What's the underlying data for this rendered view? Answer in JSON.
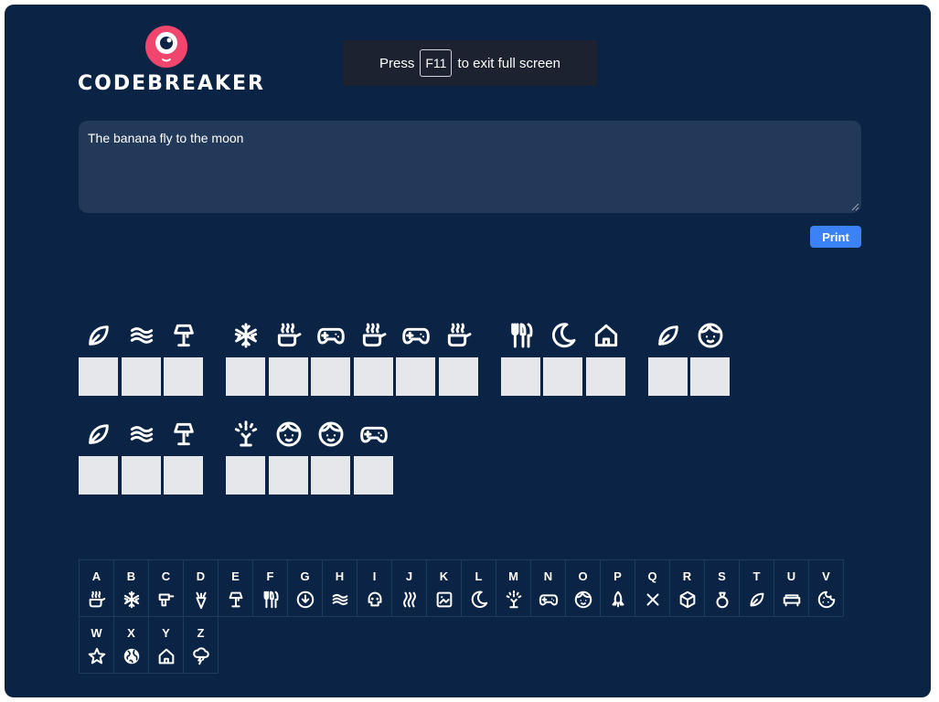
{
  "logo": {
    "text": "CODEBREAKER",
    "accent": "#f0466e"
  },
  "fullscreen_notice": {
    "prefix": "Press",
    "key": "F11",
    "suffix": "to exit full screen"
  },
  "message": {
    "value": "The banana fly to the moon"
  },
  "print_button": {
    "label": "Print",
    "color": "#3b82f6"
  },
  "colors": {
    "background": "#0b2344",
    "textarea": "#23395a",
    "blank": "#e5e7eb"
  },
  "puzzle": {
    "lines": [
      [
        [
          "leaf-icon",
          "waves-icon",
          "lamp-icon"
        ],
        [
          "snowflake-icon",
          "pot-icon",
          "gamepad-icon",
          "pot-icon",
          "gamepad-icon",
          "pot-icon"
        ],
        [
          "cutlery-icon",
          "moon-icon",
          "home-icon"
        ],
        [
          "leaf-icon",
          "face-icon"
        ]
      ],
      [
        [
          "leaf-icon",
          "waves-icon",
          "lamp-icon"
        ],
        [
          "sprinkle-icon",
          "face-icon",
          "face-icon",
          "gamepad-icon"
        ]
      ]
    ]
  },
  "key": [
    {
      "letter": "A",
      "icon": "pot-icon"
    },
    {
      "letter": "B",
      "icon": "snowflake-icon"
    },
    {
      "letter": "C",
      "icon": "drill-icon"
    },
    {
      "letter": "D",
      "icon": "carrot-icon"
    },
    {
      "letter": "E",
      "icon": "lamp-icon"
    },
    {
      "letter": "F",
      "icon": "cutlery-icon"
    },
    {
      "letter": "G",
      "icon": "download-icon"
    },
    {
      "letter": "H",
      "icon": "waves-icon"
    },
    {
      "letter": "I",
      "icon": "skull-icon"
    },
    {
      "letter": "J",
      "icon": "steam-icon"
    },
    {
      "letter": "K",
      "icon": "picture-icon"
    },
    {
      "letter": "L",
      "icon": "moon-icon"
    },
    {
      "letter": "M",
      "icon": "sprinkle-icon"
    },
    {
      "letter": "N",
      "icon": "gamepad-icon"
    },
    {
      "letter": "O",
      "icon": "face-icon"
    },
    {
      "letter": "P",
      "icon": "rocket-icon"
    },
    {
      "letter": "Q",
      "icon": "cross-icon"
    },
    {
      "letter": "R",
      "icon": "cube-icon"
    },
    {
      "letter": "S",
      "icon": "ring-icon"
    },
    {
      "letter": "T",
      "icon": "leaf-icon"
    },
    {
      "letter": "U",
      "icon": "sofa-icon"
    },
    {
      "letter": "V",
      "icon": "cookie-icon"
    },
    {
      "letter": "W",
      "icon": "star-icon"
    },
    {
      "letter": "X",
      "icon": "globe-icon"
    },
    {
      "letter": "Y",
      "icon": "home-icon"
    },
    {
      "letter": "Z",
      "icon": "storm-icon"
    }
  ]
}
